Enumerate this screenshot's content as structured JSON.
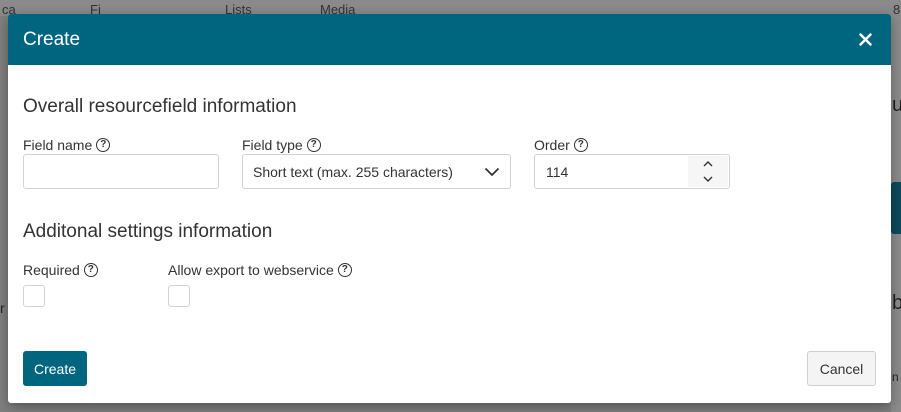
{
  "background": {
    "topbar_fragments": [
      "ca",
      "Fi",
      "Lists",
      "Media"
    ],
    "right_fragments": [
      "u",
      "b"
    ],
    "left_fragment": "r",
    "right_small": "n",
    "top_right_small": "8"
  },
  "modal": {
    "title": "Create",
    "close_label": "×",
    "section1_title": "Overall resourcefield information",
    "field_name": {
      "label": "Field name",
      "value": "",
      "help": "?"
    },
    "field_type": {
      "label": "Field type",
      "value": "Short text (max. 255 characters)",
      "help": "?"
    },
    "order": {
      "label": "Order",
      "value": "114",
      "help": "?"
    },
    "section2_title": "Additonal settings information",
    "required": {
      "label": "Required",
      "checked": false,
      "help": "?"
    },
    "allow_export": {
      "label": "Allow export to webservice",
      "checked": false,
      "help": "?"
    },
    "create_button": "Create",
    "cancel_button": "Cancel"
  },
  "colors": {
    "header": "#006680",
    "primary_button": "#006680",
    "backdrop": "#808080"
  }
}
